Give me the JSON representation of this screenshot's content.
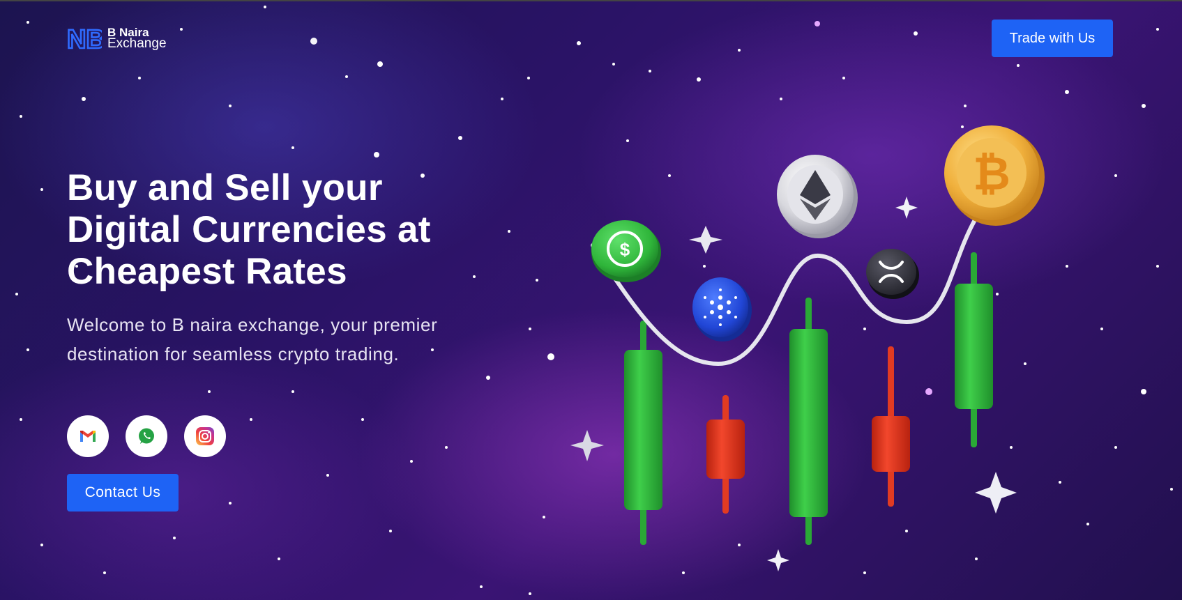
{
  "brand": {
    "name_line1": "B Naira",
    "name_line2": "Exchange",
    "logo_icon": "nb-monogram-logo",
    "accent_color": "#1e63f5"
  },
  "header": {
    "cta_label": "Trade with Us"
  },
  "hero": {
    "headline_lines": [
      "Buy and Sell your",
      "Digital Currencies at",
      "Cheapest Rates"
    ],
    "subtext": "Welcome to B naira exchange, your premier destination for seamless crypto trading.",
    "contact_label": "Contact Us",
    "socials": [
      {
        "icon": "gmail-icon"
      },
      {
        "icon": "whatsapp-icon"
      },
      {
        "icon": "instagram-icon"
      }
    ]
  },
  "illustration": {
    "coins": [
      "usd-coin",
      "cardano-coin",
      "ethereum-coin",
      "xrp-coin",
      "bitcoin-coin"
    ],
    "candles": [
      "green",
      "red",
      "green",
      "red",
      "green"
    ],
    "colors": {
      "green": "#2fb53a",
      "red": "#e8361f",
      "gold": "#f0b03c"
    }
  }
}
